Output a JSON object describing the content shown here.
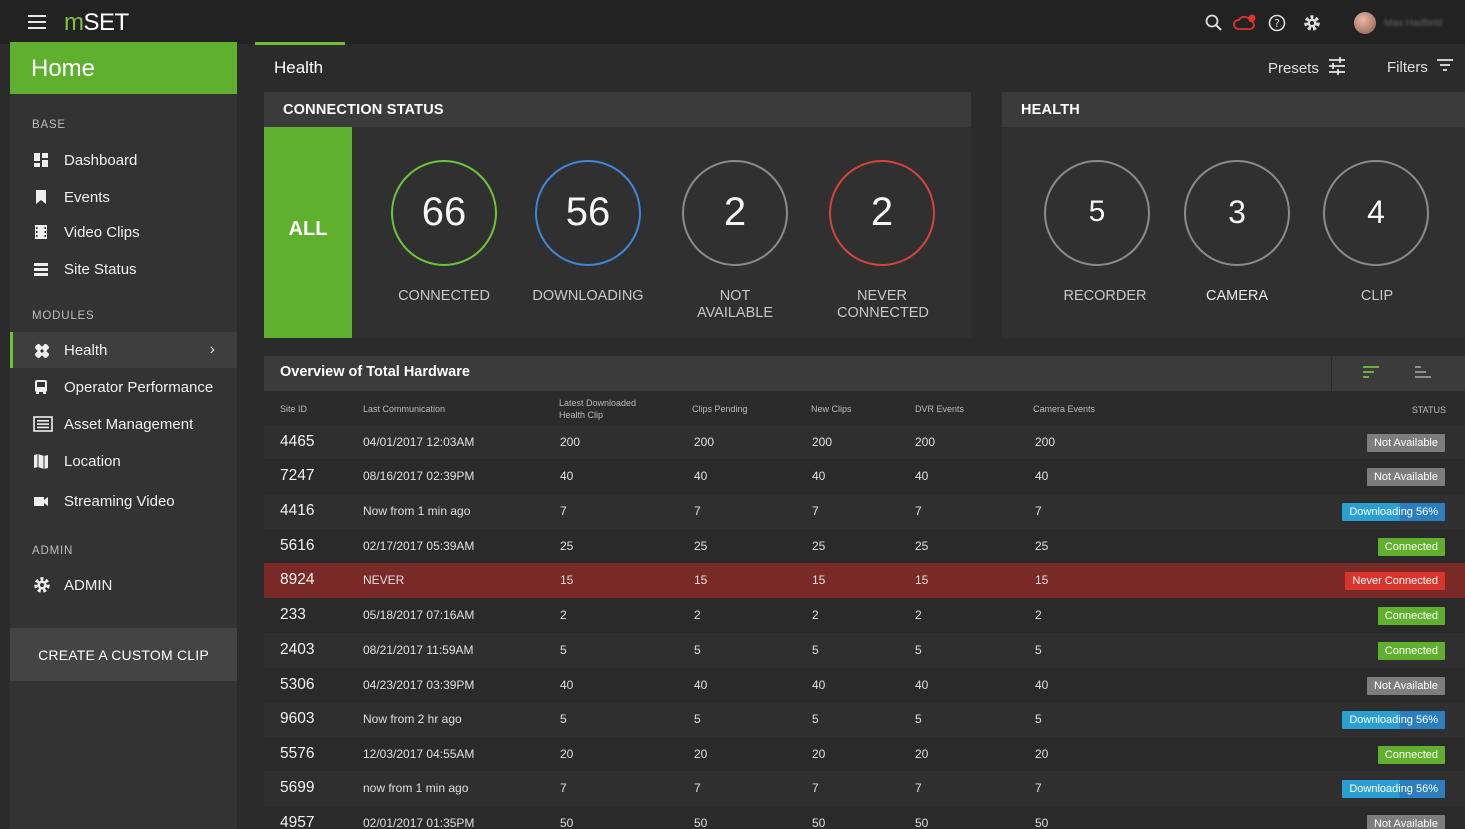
{
  "app": {
    "logo_m": "m",
    "logo_rest": "SET"
  },
  "topbar": {
    "user_name": "Max Hadfield",
    "icons": [
      "menu-icon",
      "search-icon",
      "cloud-alert-icon",
      "help-icon",
      "gear-icon",
      "avatar"
    ]
  },
  "sidebar": {
    "home": "Home",
    "section_base": "BASE",
    "base_items": [
      {
        "label": "Dashboard",
        "icon": "dashboard-icon"
      },
      {
        "label": "Events",
        "icon": "bookmark-icon"
      },
      {
        "label": "Video Clips",
        "icon": "film-icon"
      },
      {
        "label": "Site Status",
        "icon": "list-icon"
      }
    ],
    "section_modules": "MODULES",
    "module_items": [
      {
        "label": "Health",
        "icon": "health-icon"
      },
      {
        "label": "Operator Performance",
        "icon": "bus-icon"
      },
      {
        "label": "Asset Management",
        "icon": "asset-icon"
      },
      {
        "label": "Location",
        "icon": "map-icon"
      },
      {
        "label": "Streaming Video",
        "icon": "video-camera-icon"
      }
    ],
    "section_admin": "ADMIN",
    "admin_item": {
      "label": "ADMIN",
      "icon": "gear-icon"
    },
    "create_clip": "CREATE A CUSTOM CLIP"
  },
  "header": {
    "title": "Health",
    "presets": "Presets",
    "filters": "Filters"
  },
  "connection_status": {
    "title": "CONNECTION STATUS",
    "all_label": "ALL",
    "stats": [
      {
        "value": "66",
        "label": "CONNECTED",
        "color": "#6cc43a"
      },
      {
        "value": "56",
        "label": "DOWNLOADING",
        "color": "#3f86d8"
      },
      {
        "value": "2",
        "label": "NOT AVAILABLE",
        "color": "#8a8a8a"
      },
      {
        "value": "2",
        "label": "NEVER CONNECTED",
        "color": "#d6433a"
      }
    ]
  },
  "health": {
    "title": "HEALTH",
    "stats": [
      {
        "value": "5",
        "label": "RECORDER"
      },
      {
        "value": "3",
        "label": "CAMERA"
      },
      {
        "value": "4",
        "label": "CLIP"
      }
    ]
  },
  "table": {
    "title": "Overview of Total Hardware",
    "columns": [
      "Site ID",
      "Last Communication",
      "Latest Downloaded Health Clip",
      "Clips Pending",
      "New Clips",
      "DVR Events",
      "Camera Events",
      "STATUS"
    ],
    "status_colors": {
      "Not Available": "#7d7d7d",
      "Downloading": "#2a9fd6",
      "Connected": "#5fb02e",
      "Never Connected": "#d9352c",
      "highlight_row": "#7a2a26"
    },
    "rows": [
      {
        "site": "4465",
        "last": "04/01/2017  12:03AM",
        "clip": "200",
        "pending": "200",
        "new": "200",
        "dvr": "200",
        "cam": "200",
        "status": "Not Available",
        "kind": "na"
      },
      {
        "site": "7247",
        "last": "08/16/2017  02:39PM",
        "clip": "40",
        "pending": "40",
        "new": "40",
        "dvr": "40",
        "cam": "40",
        "status": "Not Available",
        "kind": "na"
      },
      {
        "site": "4416",
        "last": "Now from 1 min ago",
        "clip": "7",
        "pending": "7",
        "new": "7",
        "dvr": "7",
        "cam": "7",
        "status": "Downloading 56%",
        "kind": "dl",
        "progress": 0.56
      },
      {
        "site": "5616",
        "last": "02/17/2017  05:39AM",
        "clip": "25",
        "pending": "25",
        "new": "25",
        "dvr": "25",
        "cam": "25",
        "status": "Connected",
        "kind": "ok"
      },
      {
        "site": "8924",
        "last": "NEVER",
        "clip": "15",
        "pending": "15",
        "new": "15",
        "dvr": "15",
        "cam": "15",
        "status": "Never Connected",
        "kind": "never"
      },
      {
        "site": "233",
        "last": "05/18/2017  07:16AM",
        "clip": "2",
        "pending": "2",
        "new": "2",
        "dvr": "2",
        "cam": "2",
        "status": "Connected",
        "kind": "ok"
      },
      {
        "site": "2403",
        "last": "08/21/2017  11:59AM",
        "clip": "5",
        "pending": "5",
        "new": "5",
        "dvr": "5",
        "cam": "5",
        "status": "Connected",
        "kind": "ok"
      },
      {
        "site": "5306",
        "last": "04/23/2017  03:39PM",
        "clip": "40",
        "pending": "40",
        "new": "40",
        "dvr": "40",
        "cam": "40",
        "status": "Not Available",
        "kind": "na"
      },
      {
        "site": "9603",
        "last": "Now from 2 hr ago",
        "clip": "5",
        "pending": "5",
        "new": "5",
        "dvr": "5",
        "cam": "5",
        "status": "Downloading 56%",
        "kind": "dl",
        "progress": 0.56
      },
      {
        "site": "5576",
        "last": "12/03/2017  04:55AM",
        "clip": "20",
        "pending": "20",
        "new": "20",
        "dvr": "20",
        "cam": "20",
        "status": "Connected",
        "kind": "ok"
      },
      {
        "site": "5699",
        "last": "now from 1 min ago",
        "clip": "7",
        "pending": "7",
        "new": "7",
        "dvr": "7",
        "cam": "7",
        "status": "Downloading 56%",
        "kind": "dl",
        "progress": 0.56
      },
      {
        "site": "4957",
        "last": "02/01/2017  01:35PM",
        "clip": "50",
        "pending": "50",
        "new": "50",
        "dvr": "50",
        "cam": "50",
        "status": "Not Available",
        "kind": "na"
      }
    ]
  }
}
